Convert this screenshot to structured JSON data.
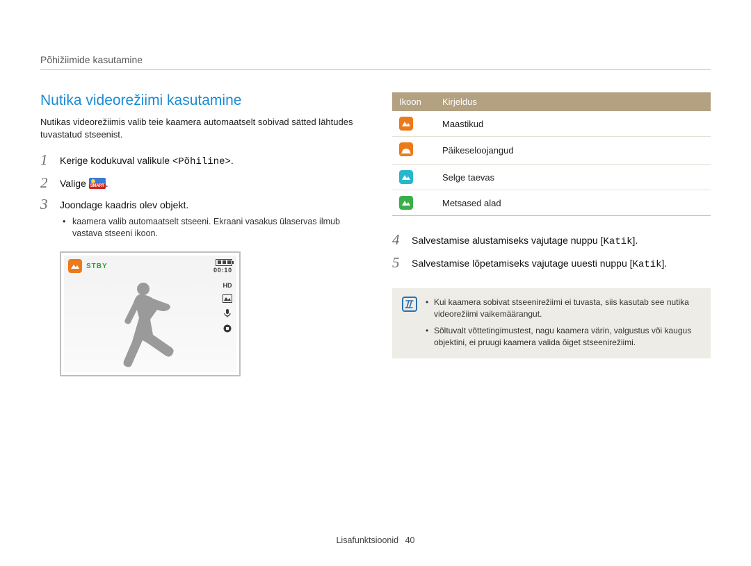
{
  "header": {
    "breadcrumb": "Põhižiimide kasutamine"
  },
  "section": {
    "title": "Nutika videorežiimi kasutamine",
    "intro": "Nutikas videorežiimis valib teie kaamera automaatselt sobivad sätted lähtudes tuvastatud stseenist."
  },
  "steps_left": [
    {
      "num": "1",
      "text_pre": "Kerige kodukuval valikule ",
      "mono": "<Põhiline>",
      "text_post": "."
    },
    {
      "num": "2",
      "text_pre": "Valige ",
      "has_icon": true,
      "text_post": "."
    },
    {
      "num": "3",
      "text_pre": "Joondage kaadris olev objekt.",
      "sub": [
        "kaamera valib automaatselt stseeni. Ekraani vasakus ülaservas ilmub vastava stseeni ikoon."
      ]
    }
  ],
  "preview": {
    "stby": "STBY",
    "timer": "00:10",
    "hd": "HD",
    "pic": "฿"
  },
  "icon_table": {
    "headers": [
      "Ikoon",
      "Kirjeldus"
    ],
    "rows": [
      {
        "desc": "Maastikud"
      },
      {
        "desc": "Päikeseloojangud"
      },
      {
        "desc": "Selge taevas"
      },
      {
        "desc": "Metsased alad"
      }
    ]
  },
  "steps_right": [
    {
      "num": "4",
      "text_pre": "Salvestamise alustamiseks vajutage nuppu [",
      "mono": "Katik",
      "text_post": "]."
    },
    {
      "num": "5",
      "text_pre": "Salvestamise lõpetamiseks vajutage uuesti nuppu [",
      "mono": "Katik",
      "text_post": "]."
    }
  ],
  "note": {
    "items": [
      "Kui kaamera sobivat stseenirežiimi ei tuvasta, siis kasutab see nutika videorežiimi vaikemäärangut.",
      "Sõltuvalt võttetingimustest, nagu kaamera värin, valgustus või kaugus objektini, ei pruugi kaamera valida õiget stseenirežiimi."
    ]
  },
  "footer": {
    "label": "Lisafunktsioonid",
    "page": "40"
  }
}
